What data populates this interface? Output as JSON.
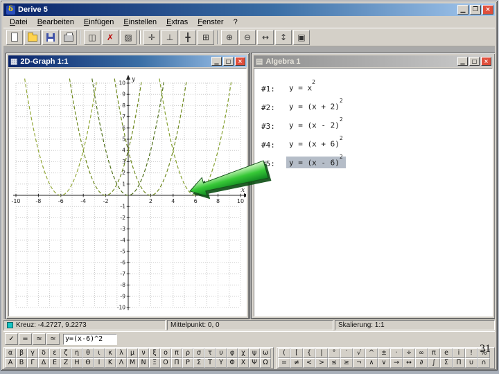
{
  "slide": {
    "page_number": "31"
  },
  "window": {
    "title": "Derive 5",
    "icon_glyph": "δ",
    "controls": {
      "minimize": "▁",
      "maximize": "❐",
      "close": "×"
    }
  },
  "menu": {
    "items": [
      "Datei",
      "Bearbeiten",
      "Einfügen",
      "Einstellen",
      "Extras",
      "Fenster",
      "?"
    ]
  },
  "toolbar": {
    "glyphs": {
      "copy": "◫",
      "delete": "✗",
      "pattern": "▨",
      "cross": "✛",
      "perp": "⊥",
      "center": "╋",
      "grid": "⊞",
      "zoom_in": "⊕",
      "zoom_out": "⊖",
      "zoom_h": "↔",
      "zoom_v": "↕",
      "fit": "▣"
    }
  },
  "graph_window": {
    "title": "2D-Graph 1:1",
    "icon": "▦",
    "controls": {
      "minimize": "▁",
      "maximize": "□",
      "close": "×"
    }
  },
  "algebra_window": {
    "title": "Algebra 1",
    "icon": "▤",
    "controls": {
      "minimize": "▁",
      "maximize": "□",
      "close": "×"
    },
    "rows": [
      {
        "label": "#1:",
        "base": "y = x",
        "sup": "2"
      },
      {
        "label": "#2:",
        "base": "y = (x + 2)",
        "sup": "2"
      },
      {
        "label": "#3:",
        "base": "y = (x - 2)",
        "sup": "2"
      },
      {
        "label": "#4:",
        "base": "y = (x + 6)",
        "sup": "2"
      },
      {
        "label": "#5:",
        "base": "y = (x - 6)",
        "sup": "2",
        "highlighted": true
      }
    ]
  },
  "statusbar": {
    "cross": "Kreuz: -4.2727, 9.2273",
    "center": "Mittelpunkt: 0, 0",
    "scale": "Skalierung: 1:1"
  },
  "entry": {
    "buttons": [
      "✓",
      "=",
      "≈",
      "≃"
    ],
    "value": "y=(x-6)^2"
  },
  "symbols": {
    "greek_lower": [
      "α",
      "β",
      "γ",
      "δ",
      "ε",
      "ζ",
      "η",
      "θ",
      "ι",
      "κ",
      "λ",
      "μ",
      "ν",
      "ξ",
      "ο",
      "π",
      "ρ",
      "σ",
      "τ",
      "υ",
      "φ",
      "χ",
      "ψ",
      "ω"
    ],
    "greek_upper": [
      "Α",
      "Β",
      "Γ",
      "Δ",
      "Ε",
      "Ζ",
      "Η",
      "Θ",
      "Ι",
      "Κ",
      "Λ",
      "Μ",
      "Ν",
      "Ξ",
      "Ο",
      "Π",
      "Ρ",
      "Σ",
      "Τ",
      "Υ",
      "Φ",
      "Χ",
      "Ψ",
      "Ω"
    ],
    "math_row1": [
      "(",
      "[",
      "{",
      "|",
      "°",
      "′",
      "√",
      "^",
      "±",
      "·",
      "÷",
      "∞",
      "π",
      "e",
      "i",
      "!",
      "%"
    ],
    "math_row2": [
      "=",
      "≠",
      "<",
      ">",
      "≤",
      "≥",
      "¬",
      "∧",
      "∨",
      "→",
      "↔",
      "∂",
      "∫",
      "Σ",
      "Π",
      "∪",
      "∩"
    ]
  },
  "chart_data": {
    "type": "line",
    "title": "",
    "xlabel": "x",
    "ylabel": "y",
    "xlim": [
      -10,
      10
    ],
    "ylim": [
      -10,
      10
    ],
    "grid": true,
    "x_tick_labels": [
      -10,
      -8,
      -6,
      -4,
      -2,
      2,
      4,
      6,
      8,
      10
    ],
    "y_tick_min": -10,
    "y_tick_max": 10,
    "series": [
      {
        "name": "y = x^2",
        "vertex": 0,
        "color": "#4f6f1a"
      },
      {
        "name": "y = (x + 2)^2",
        "vertex": -2,
        "color": "#6f8a1f"
      },
      {
        "name": "y = (x - 2)^2",
        "vertex": 2,
        "color": "#6f8a1f"
      },
      {
        "name": "y = (x + 6)^2",
        "vertex": -6,
        "color": "#93a83a"
      },
      {
        "name": "y = (x - 6)^2",
        "vertex": 6,
        "color": "#85a030"
      }
    ],
    "axis_color": "#222222",
    "grid_color": "#c9c9c9",
    "annotation": "green-arrow-pointing-to-vertex-6-0"
  }
}
